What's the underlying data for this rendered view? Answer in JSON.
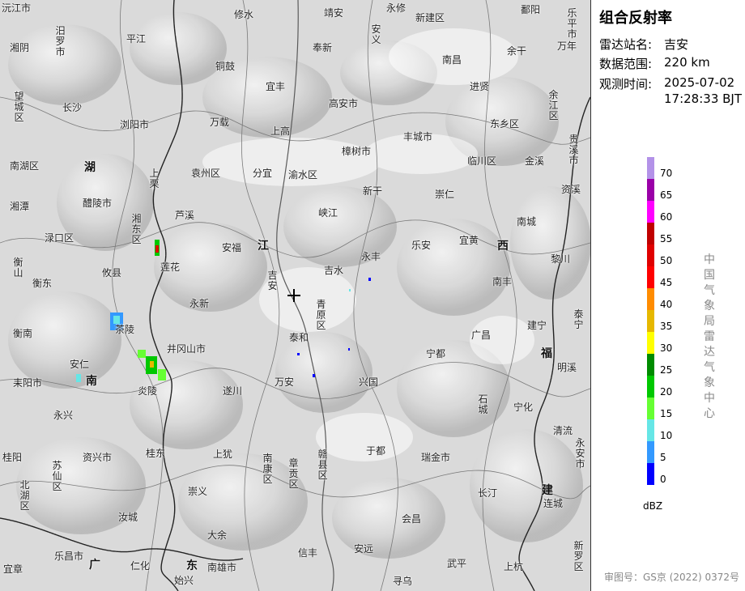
{
  "panel": {
    "title": "组合反射率",
    "station_label": "雷达站名:",
    "station_value": "吉安",
    "range_label": "数据范围:",
    "range_value": "220 km",
    "time_label": "观测时间:",
    "time_date": "2025-07-02",
    "time_clock": "17:28:33 BJT",
    "legend_unit": "dBZ",
    "legend_ticks": [
      "70",
      "65",
      "60",
      "55",
      "50",
      "45",
      "40",
      "35",
      "30",
      "25",
      "20",
      "15",
      "10",
      "5",
      "0"
    ],
    "legend_colors": [
      "#b392e8",
      "#9a00a8",
      "#ff00ff",
      "#c00000",
      "#e00000",
      "#ff0000",
      "#ff8c00",
      "#e6b800",
      "#ffff00",
      "#008c00",
      "#00c800",
      "#66ff33",
      "#66e6e6",
      "#3399ff",
      "#0000ff"
    ],
    "agency": "中国气象局雷达气象中心",
    "approval": "审图号：GS京 (2022) 0372号"
  },
  "map": {
    "places": [
      "沅江市",
      "修水",
      "靖安",
      "永修",
      "新建区",
      "鄱阳",
      "乐平市",
      "汨罗市",
      "平江",
      "奉新",
      "安义",
      "湘阴",
      "铜鼓",
      "南昌",
      "余干",
      "万年",
      "宜丰",
      "进贤",
      "望城区",
      "长沙",
      "高安市",
      "余江区",
      "浏阳市",
      "万载",
      "东乡区",
      "贵溪市",
      "上高",
      "丰城市",
      "樟树市",
      "临川区",
      "金溪",
      "南湖区",
      "上栗",
      "袁州区",
      "分宜",
      "渝水区",
      "新干",
      "崇仁",
      "资溪",
      "湘潭",
      "醴陵市",
      "芦溪",
      "峡江",
      "南城",
      "湘东区",
      "渌口区",
      "安福",
      "乐安",
      "宜黄",
      "黎川",
      "衡山",
      "莲花",
      "吉水",
      "永丰",
      "衡东",
      "攸县",
      "吉安",
      "南丰",
      "永新",
      "青原区",
      "泰宁",
      "衡南",
      "茶陵",
      "建宁",
      "泰和",
      "广昌",
      "井冈山市",
      "宁都",
      "安仁",
      "明溪",
      "耒阳市",
      "万安",
      "兴国",
      "炎陵",
      "石城",
      "宁化",
      "遂川",
      "永兴",
      "于都",
      "清流",
      "桂阳",
      "资兴市",
      "桂东",
      "上犹",
      "南康区",
      "章贡区",
      "赣县区",
      "瑞金市",
      "永安市",
      "苏仙区",
      "北湖区",
      "崇义",
      "长汀",
      "连城",
      "汝城",
      "会昌",
      "大余",
      "安远",
      "信丰",
      "乐昌市",
      "南雄市",
      "仁化",
      "新罗区",
      "宜章",
      "武平",
      "上杭",
      "始兴",
      "寻乌"
    ],
    "provinces": [
      "湖",
      "南",
      "江",
      "西",
      "福",
      "建",
      "广",
      "东"
    ],
    "radar_symbol": "+"
  }
}
